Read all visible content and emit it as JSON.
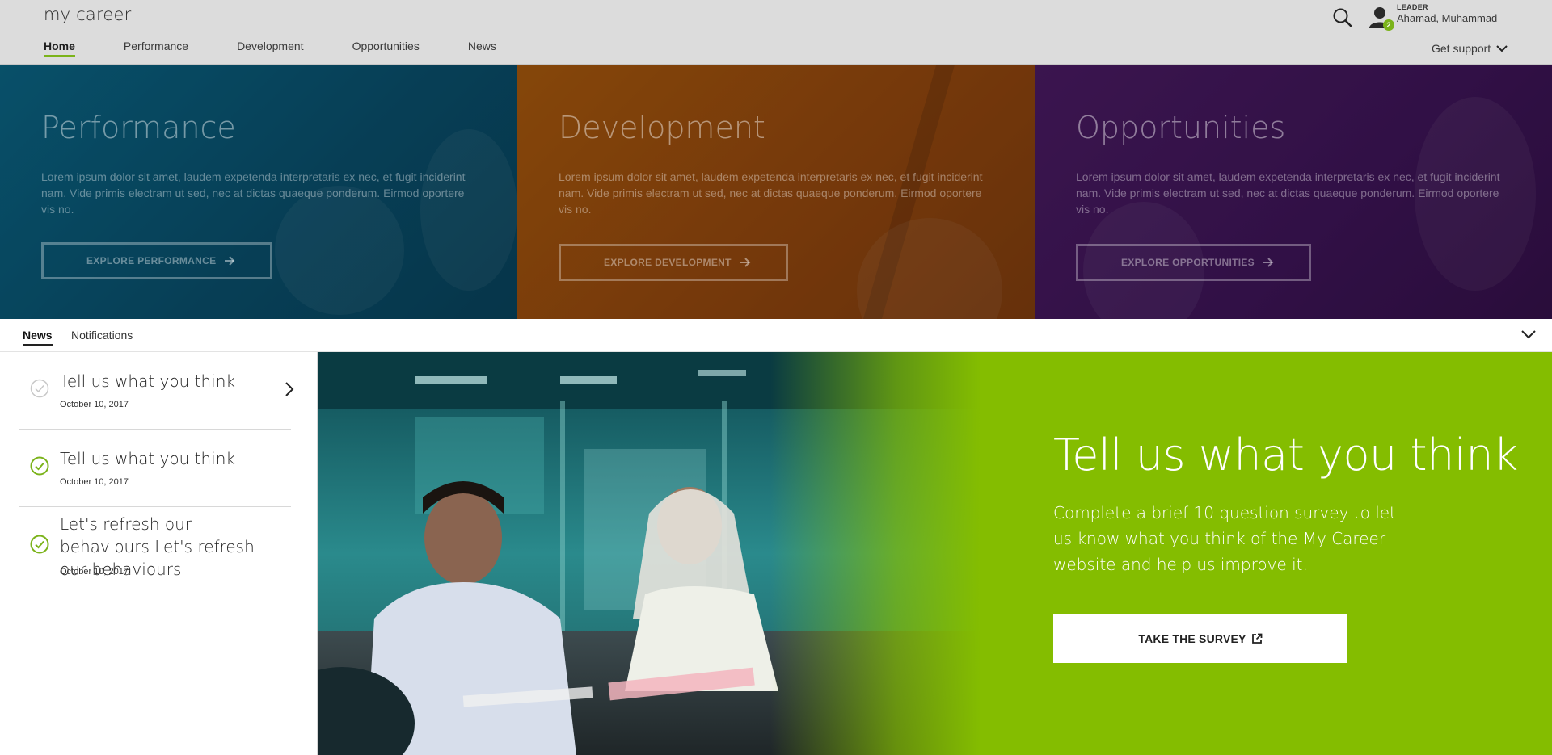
{
  "header": {
    "logo": "my career",
    "nav": [
      {
        "label": "Home",
        "active": true
      },
      {
        "label": "Performance",
        "active": false
      },
      {
        "label": "Development",
        "active": false
      },
      {
        "label": "Opportunities",
        "active": false
      },
      {
        "label": "News",
        "active": false
      }
    ],
    "user": {
      "role": "LEADER",
      "name": "Ahamad, Muhammad",
      "badge": "2"
    },
    "support_label": "Get support"
  },
  "hero": {
    "panels": [
      {
        "title": "Performance",
        "description": "Lorem ipsum dolor sit amet, laudem expetenda interpretaris ex nec, et fugit inciderint nam. Vide primis electram ut sed, nec at dictas quaeque ponderum. Eirmod oportere vis no.",
        "button": "EXPLORE PERFORMANCE",
        "color": "#0b5f7d"
      },
      {
        "title": "Development",
        "description": "Lorem ipsum dolor sit amet, laudem expetenda interpretaris ex nec, et fugit inciderint nam. Vide primis electram ut sed, nec at dictas quaeque ponderum. Eirmod oportere vis no.",
        "button": "EXPLORE DEVELOPMENT",
        "color": "#a8520f"
      },
      {
        "title": "Opportunities",
        "description": "Lorem ipsum dolor sit amet, laudem expetenda interpretaris ex nec, et fugit inciderint nam. Vide primis electram ut sed, nec at dictas quaeque ponderum. Eirmod oportere vis no.",
        "button": "EXPLORE OPPORTUNITIES",
        "color": "#4a1a62"
      }
    ]
  },
  "tabs": [
    {
      "label": "News",
      "active": true
    },
    {
      "label": "Notifications",
      "active": false
    }
  ],
  "news": [
    {
      "title": "Tell us what you think",
      "date": "October 10, 2017",
      "read": false,
      "selected": true
    },
    {
      "title": "Tell us what you think",
      "date": "October 10, 2017",
      "read": true,
      "selected": false
    },
    {
      "title": "Let's refresh our behaviours Let's refresh our behaviours",
      "date": "October 10, 2017",
      "read": true,
      "selected": false
    }
  ],
  "feature": {
    "title": "Tell us what you think",
    "description": "Complete a brief 10 question survey to let us know what you think of the My Career website and help us improve it.",
    "button": "TAKE THE SURVEY",
    "accent": "#84bd00"
  },
  "icons": {
    "search": "search-icon",
    "user": "user-icon",
    "chevron": "chevron-down-icon",
    "arrow": "arrow-right-icon",
    "check": "check-circle-icon",
    "external": "external-link-icon"
  }
}
